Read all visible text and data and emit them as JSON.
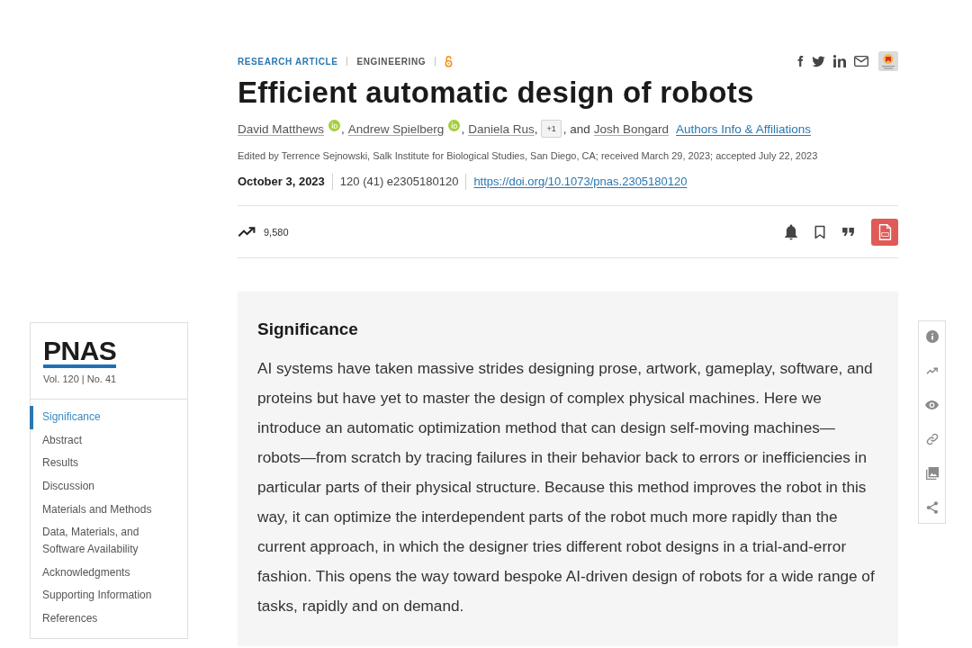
{
  "header": {
    "article_type": "RESEARCH ARTICLE",
    "subject": "ENGINEERING"
  },
  "title": "Efficient automatic design of robots",
  "byline": [
    {
      "kind": "author",
      "name": "David Matthews",
      "orcid": true
    },
    {
      "kind": "text",
      "text": ","
    },
    {
      "kind": "author",
      "name": "Andrew Spielberg",
      "orcid": true
    },
    {
      "kind": "text",
      "text": ","
    },
    {
      "kind": "author",
      "name": "Daniela Rus",
      "orcid": false
    },
    {
      "kind": "text",
      "text": ","
    },
    {
      "kind": "more",
      "text": "+1"
    },
    {
      "kind": "text",
      "text": ", and"
    },
    {
      "kind": "author",
      "name": "Josh Bongard",
      "orcid": false
    },
    {
      "kind": "link",
      "text": "Authors Info & Affiliations"
    }
  ],
  "editor_note": "Edited by Terrence Sejnowski, Salk Institute for Biological Studies, San Diego, CA; received March 29, 2023; accepted July 22, 2023",
  "publication": {
    "date": "October 3, 2023",
    "citation": "120 (41) e2305180120",
    "doi": "https://doi.org/10.1073/pnas.2305180120"
  },
  "metrics": {
    "views": "9,580"
  },
  "sidebar": {
    "logo": "PNAS",
    "issue": "Vol. 120 | No. 41",
    "items": [
      {
        "label": "Significance",
        "selected": true
      },
      {
        "label": "Abstract",
        "selected": false
      },
      {
        "label": "Results",
        "selected": false
      },
      {
        "label": "Discussion",
        "selected": false
      },
      {
        "label": "Materials and Methods",
        "selected": false
      },
      {
        "label": "Data, Materials, and Software Availability",
        "selected": false
      },
      {
        "label": "Acknowledgments",
        "selected": false
      },
      {
        "label": "Supporting Information",
        "selected": false
      },
      {
        "label": "References",
        "selected": false
      }
    ]
  },
  "significance": {
    "heading": "Significance",
    "text": "AI systems have taken massive strides designing prose, artwork, gameplay, software, and proteins but have yet to master the design of complex physical machines. Here we introduce an automatic optimization method that can design self-moving machines—robots—from scratch by tracing failures in their behavior back to errors or inefficiencies in particular parts of their physical structure. Because this method improves the robot in this way, it can optimize the interdependent parts of the robot much more rapidly than the current approach, in which the designer tries different robot designs in a trial-and-error fashion. This opens the way toward bespoke AI-driven design of robots for a wide range of tasks, rapidly and on demand."
  }
}
